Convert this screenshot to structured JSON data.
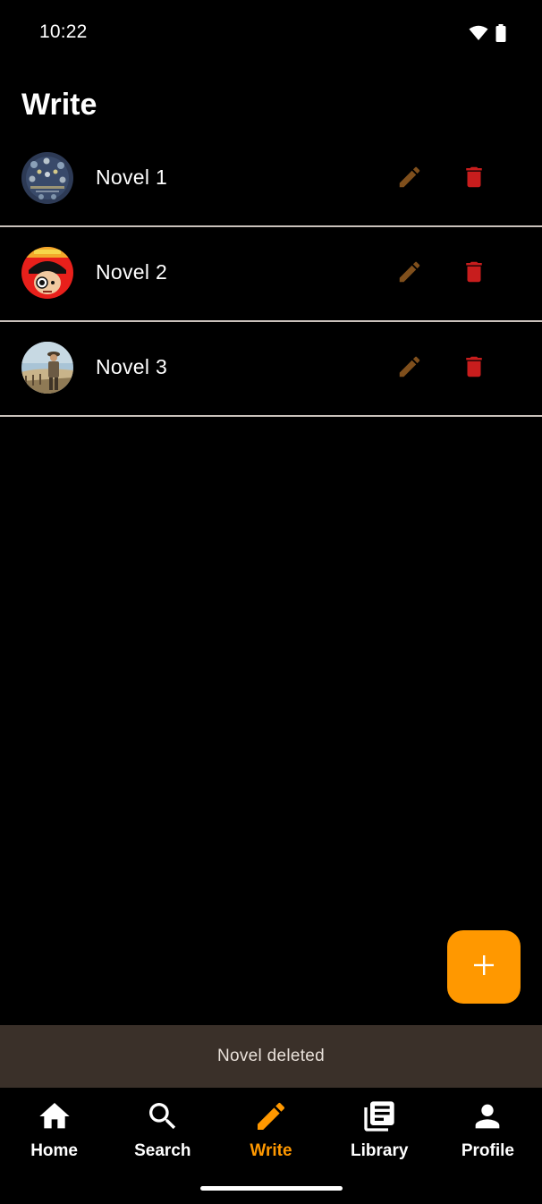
{
  "status_bar": {
    "time": "10:22",
    "icons": [
      "wifi-icon",
      "battery-icon"
    ]
  },
  "page": {
    "title": "Write"
  },
  "novels": [
    {
      "title": "Novel 1",
      "cover": "peacock-cover"
    },
    {
      "title": "Novel 2",
      "cover": "orange-cover"
    },
    {
      "title": "Novel 3",
      "cover": "farmer-cover"
    }
  ],
  "row_actions": {
    "edit_icon": "pencil-icon",
    "delete_icon": "trash-icon"
  },
  "fab": {
    "icon": "plus-icon"
  },
  "snackbar": {
    "message": "Novel deleted"
  },
  "bottom_nav": {
    "items": [
      {
        "label": "Home",
        "icon": "home-icon",
        "active": false
      },
      {
        "label": "Search",
        "icon": "search-icon",
        "active": false
      },
      {
        "label": "Write",
        "icon": "pencil-icon",
        "active": true
      },
      {
        "label": "Library",
        "icon": "library-icon",
        "active": false
      },
      {
        "label": "Profile",
        "icon": "person-icon",
        "active": false
      }
    ]
  },
  "colors": {
    "background": "#000000",
    "accent": "#ff9800",
    "edit": "#7f4f1c",
    "delete": "#c81d1d",
    "divider": "#c9c1bb",
    "snackbar": "#3a3029"
  }
}
